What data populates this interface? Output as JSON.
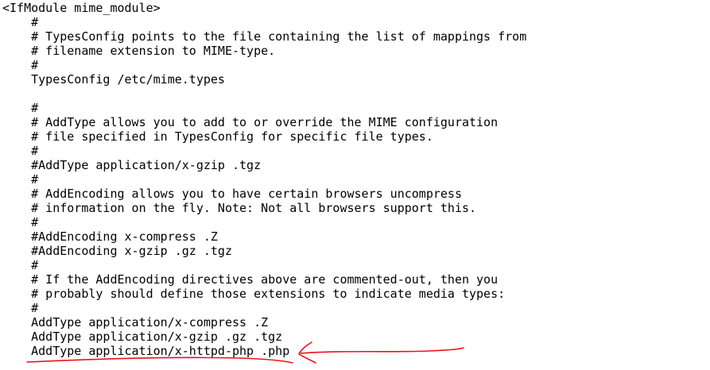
{
  "lines": [
    "<IfModule mime_module>",
    "    #",
    "    # TypesConfig points to the file containing the list of mappings from",
    "    # filename extension to MIME-type.",
    "    #",
    "    TypesConfig /etc/mime.types",
    "",
    "    #",
    "    # AddType allows you to add to or override the MIME configuration",
    "    # file specified in TypesConfig for specific file types.",
    "    #",
    "    #AddType application/x-gzip .tgz",
    "    #",
    "    # AddEncoding allows you to have certain browsers uncompress",
    "    # information on the fly. Note: Not all browsers support this.",
    "    #",
    "    #AddEncoding x-compress .Z",
    "    #AddEncoding x-gzip .gz .tgz",
    "    #",
    "    # If the AddEncoding directives above are commented-out, then you",
    "    # probably should define those extensions to indicate media types:",
    "    #",
    "    AddType application/x-compress .Z",
    "    AddType application/x-gzip .gz .tgz",
    "    AddType application/x-httpd-php .php"
  ],
  "annotation": {
    "color": "#e8141a",
    "highlighted_line": 25
  }
}
